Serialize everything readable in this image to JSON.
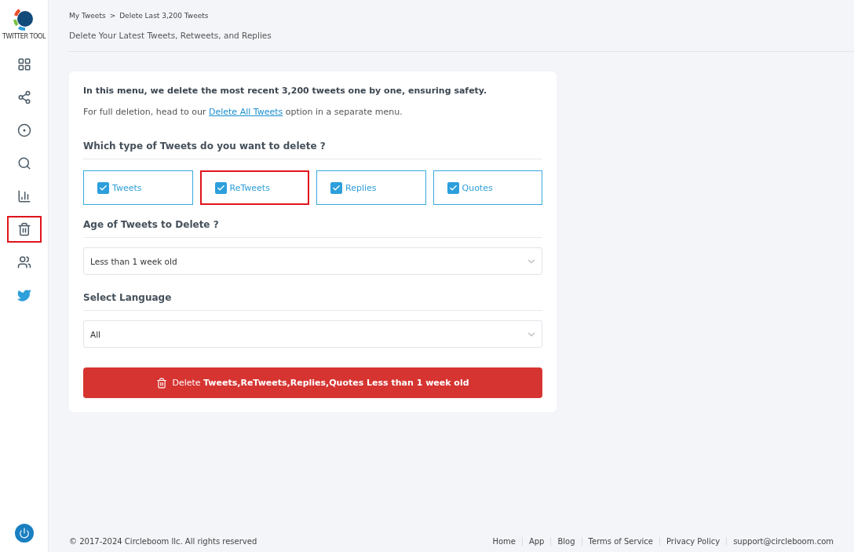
{
  "logo": {
    "caption": "TWITTER TOOL"
  },
  "sidebar": {
    "items": [
      {
        "kind": "dashboard",
        "highlighted": false
      },
      {
        "kind": "network",
        "highlighted": false
      },
      {
        "kind": "target",
        "highlighted": false
      },
      {
        "kind": "search",
        "highlighted": false
      },
      {
        "kind": "chart",
        "highlighted": false
      },
      {
        "kind": "trash",
        "highlighted": true
      },
      {
        "kind": "people",
        "highlighted": false
      },
      {
        "kind": "bird",
        "highlighted": false
      }
    ]
  },
  "breadcrumb": [
    "My Tweets",
    "Delete Last 3,200 Tweets"
  ],
  "breadcrumb_separator": ">",
  "page_subtitle": "Delete Your Latest Tweets, Retweets, and Replies",
  "card": {
    "intro": "In this menu, we delete the most recent 3,200 tweets one by one, ensuring safety.",
    "note_before": "For full deletion, head to our",
    "note_link": "Delete All Tweets",
    "note_after": "option in a separate menu.",
    "type_heading": "Which type of Tweets do you want to delete ?",
    "types": [
      {
        "label": "Tweets",
        "checked": true,
        "highlighted": false
      },
      {
        "label": "ReTweets",
        "checked": true,
        "highlighted": true
      },
      {
        "label": "Replies",
        "checked": true,
        "highlighted": false
      },
      {
        "label": "Quotes",
        "checked": true,
        "highlighted": false
      }
    ],
    "age_heading": "Age of Tweets to Delete ?",
    "age_value": "Less than 1 week old",
    "language_heading": "Select Language",
    "language_value": "All",
    "delete_button": "Delete **Tweets,ReTweets,Replies,Quotes Less than 1 week old**"
  },
  "footer": {
    "copyright": "© 2017-2024 Circleboom llc. All rights reserved",
    "links": [
      "Home",
      "App",
      "Blog",
      "Terms of Service",
      "Privacy Policy",
      "support@circleboom.com"
    ]
  }
}
